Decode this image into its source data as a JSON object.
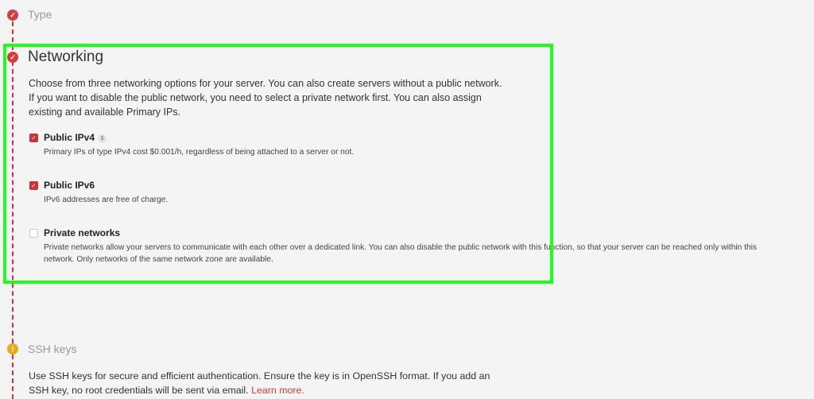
{
  "steps": {
    "type": {
      "title": "Type",
      "status_icon": "check-icon"
    },
    "networking": {
      "title": "Networking",
      "status_icon": "check-icon",
      "description": "Choose from three networking options for your server. You can also create servers without a public network. If you want to disable the public network, you need to select a private network first. You can also assign existing and available Primary IPs.",
      "options": [
        {
          "label": "Public IPv4",
          "badge": "$",
          "checked": true,
          "description": "Primary IPs of type IPv4 cost $0.001/h, regardless of being attached to a server or not."
        },
        {
          "label": "Public IPv6",
          "checked": true,
          "description": "IPv6 addresses are free of charge."
        },
        {
          "label": "Private networks",
          "checked": false,
          "description": "Private networks allow your servers to communicate with each other over a dedicated link. You can also disable the public network with this function, so that your server can be reached only within this network. Only networks of the same network zone are available."
        }
      ]
    },
    "ssh_keys": {
      "title": "SSH keys",
      "status_icon": "warning-icon",
      "description": "Use SSH keys for secure and efficient authentication. Ensure the key is in OpenSSH format. If you add an SSH key, no root credentials will be sent via email.",
      "link": "Learn more."
    }
  },
  "colors": {
    "accent": "#d63d3d",
    "warning": "#e8a91a",
    "highlight": "#1fff1f",
    "background": "#f4f4f4"
  }
}
